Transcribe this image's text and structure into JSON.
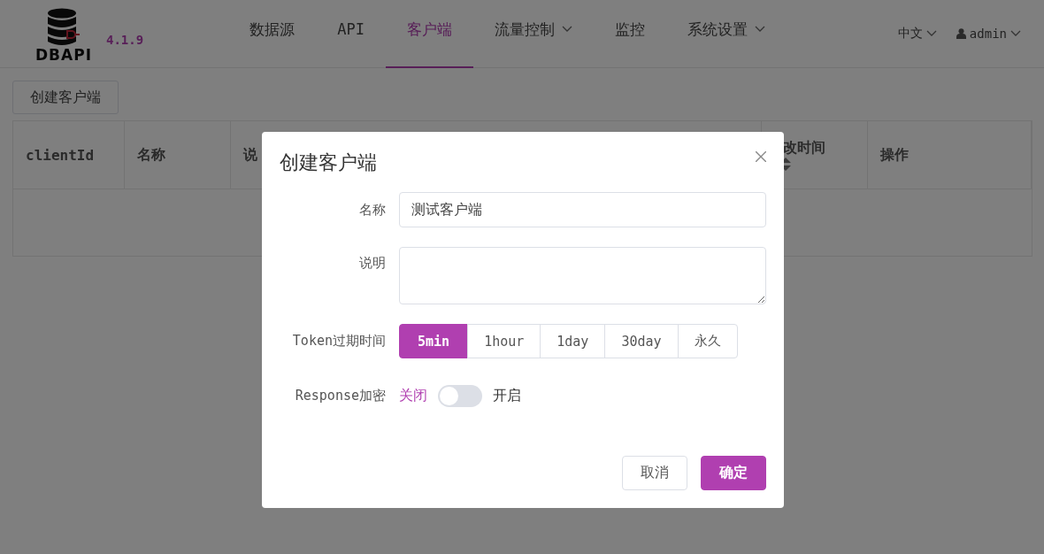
{
  "header": {
    "logo_text": "DBAPI",
    "version": "4.1.9",
    "nav": [
      {
        "label": "数据源",
        "selected": false,
        "dropdown": false
      },
      {
        "label": "API",
        "selected": false,
        "dropdown": false
      },
      {
        "label": "客户端",
        "selected": true,
        "dropdown": false
      },
      {
        "label": "流量控制",
        "selected": false,
        "dropdown": true
      },
      {
        "label": "监控",
        "selected": false,
        "dropdown": false
      },
      {
        "label": "系统设置",
        "selected": false,
        "dropdown": true
      }
    ],
    "language": "中文",
    "user": "admin"
  },
  "toolbar": {
    "create_button": "创建客户端"
  },
  "table": {
    "columns": [
      {
        "label": "clientId",
        "sortable": false
      },
      {
        "label": "名称",
        "sortable": false
      },
      {
        "label": "说",
        "sortable": false
      },
      {
        "label": "改时间",
        "sortable": true
      },
      {
        "label": "操作",
        "sortable": false
      }
    ]
  },
  "dialog": {
    "title": "创建客户端",
    "name_field": {
      "label": "名称",
      "value": "测试客户端"
    },
    "description_field": {
      "label": "说明"
    },
    "token_expiry": {
      "label": "Token过期时间",
      "options": [
        {
          "label": "5min",
          "selected": true
        },
        {
          "label": "1hour",
          "selected": false
        },
        {
          "label": "1day",
          "selected": false
        },
        {
          "label": "30day",
          "selected": false
        },
        {
          "label": "永久",
          "selected": false
        }
      ]
    },
    "encryption": {
      "label": "Response加密",
      "off_label": "关闭",
      "on_label": "开启",
      "on": false
    },
    "buttons": [
      {
        "label": "取消",
        "kind": "secondary"
      },
      {
        "label": "确定",
        "kind": "primary"
      }
    ]
  }
}
